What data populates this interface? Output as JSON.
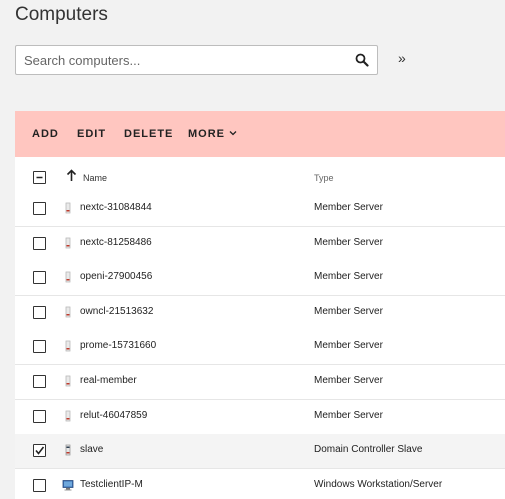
{
  "page": {
    "title": "Computers"
  },
  "search": {
    "placeholder": "Search computers...",
    "value": ""
  },
  "expand_label": "»",
  "toolbar": {
    "add": "ADD",
    "edit": "EDIT",
    "delete": "DELETE",
    "more": "MORE"
  },
  "columns": {
    "name": "Name",
    "type": "Type",
    "sort": "ascending"
  },
  "rows": [
    {
      "name": "nextc-31084844",
      "type": "Member Server",
      "icon": "server-icon",
      "checked": false
    },
    {
      "name": "nextc-81258486",
      "type": "Member Server",
      "icon": "server-icon",
      "checked": false
    },
    {
      "name": "openi-27900456",
      "type": "Member Server",
      "icon": "server-icon",
      "checked": false
    },
    {
      "name": "owncl-21513632",
      "type": "Member Server",
      "icon": "server-icon",
      "checked": false
    },
    {
      "name": "prome-15731660",
      "type": "Member Server",
      "icon": "server-icon",
      "checked": false
    },
    {
      "name": "real-member",
      "type": "Member Server",
      "icon": "server-icon",
      "checked": false
    },
    {
      "name": "relut-46047859",
      "type": "Member Server",
      "icon": "server-icon",
      "checked": false
    },
    {
      "name": "slave",
      "type": "Domain Controller Slave",
      "icon": "domain-controller-icon",
      "checked": true
    },
    {
      "name": "TestclientIP-M",
      "type": "Windows Workstation/Server",
      "icon": "windows-workstation-icon",
      "checked": false
    }
  ],
  "colors": {
    "toolbar_bg": "#ffc6c0",
    "page_bg": "#f2f2f2"
  }
}
